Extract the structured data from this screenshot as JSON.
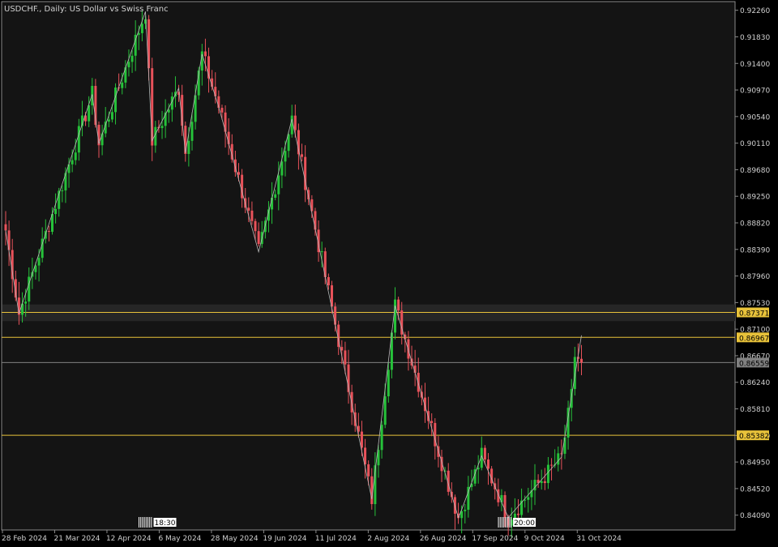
{
  "chart_data": {
    "type": "candlestick",
    "title": "USDCHF., Daily:  US Dollar vs Swiss Franc",
    "symbol": "USDCHF.",
    "timeframe": "Daily",
    "y_ticks": [
      "0.92260",
      "0.91830",
      "0.91400",
      "0.90970",
      "0.90540",
      "0.90110",
      "0.89680",
      "0.89250",
      "0.88820",
      "0.88390",
      "0.87960",
      "0.87530",
      "0.87100",
      "0.86670",
      "0.86240",
      "0.85810",
      "0.85380",
      "0.84950",
      "0.84520",
      "0.84090"
    ],
    "x_ticks": [
      "28 Feb 2024",
      "21 Mar 2024",
      "12 Apr 2024",
      "6 May 2024",
      "28 May 2024",
      "19 Jun 2024",
      "11 Jul 2024",
      "2 Aug 2024",
      "26 Aug 2024",
      "17 Sep 2024",
      "9 Oct 2024",
      "31 Oct 2024"
    ],
    "ylim": [
      0.8385,
      0.924
    ],
    "grid": false,
    "levels": [
      {
        "name": "resistance-upper",
        "value": 0.87371,
        "label": "0.87371",
        "color": "#e8c23a"
      },
      {
        "name": "resistance-lower",
        "value": 0.86967,
        "label": "0.86967",
        "color": "#e8c23a"
      },
      {
        "name": "current-price",
        "value": 0.86559,
        "label": "0.86559",
        "color": "#808080"
      },
      {
        "name": "support",
        "value": 0.85382,
        "label": "0.85382",
        "color": "#e8c23a"
      }
    ],
    "zone": {
      "from": 0.8723,
      "to": 0.875,
      "color": "#262626"
    },
    "zigzag": [
      [
        0,
        0.887
      ],
      [
        4,
        0.8735
      ],
      [
        26,
        0.909
      ],
      [
        28,
        0.901
      ],
      [
        42,
        0.9224
      ],
      [
        44,
        0.9015
      ],
      [
        52,
        0.91
      ],
      [
        54,
        0.8995
      ],
      [
        59,
        0.9155
      ],
      [
        64,
        0.907
      ],
      [
        76,
        0.8835
      ],
      [
        86,
        0.905
      ],
      [
        90,
        0.895
      ],
      [
        110,
        0.8435
      ],
      [
        117,
        0.8748
      ],
      [
        136,
        0.8405
      ],
      [
        137,
        0.8418
      ],
      [
        143,
        0.8505
      ],
      [
        151,
        0.8405
      ],
      [
        167,
        0.8503
      ],
      [
        173,
        0.87
      ]
    ],
    "session_markers": [
      {
        "label": "18:30",
        "index": 42
      },
      {
        "label": "20:00",
        "index": 150
      }
    ],
    "colors": {
      "up": "#26c23a",
      "down": "#e8525a",
      "background": "#141414",
      "frame": "#8a8a8a",
      "zigzag": "#b8b8b8",
      "text": "#d0d0d0"
    }
  }
}
